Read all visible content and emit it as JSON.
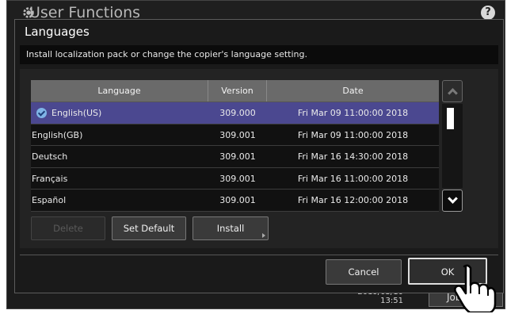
{
  "app": {
    "title": "User Functions",
    "help_label": "?",
    "time_line1": "2019/03/10",
    "time_line2": "13:51",
    "job_button": "Job S"
  },
  "dialog": {
    "title": "Languages",
    "description": "Install localization pack or change the copier's language setting.",
    "columns": [
      "Language",
      "Version",
      "Date"
    ],
    "rows": [
      {
        "language": "English(US)",
        "version": "309.000",
        "date": "Fri Mar 09 11:00:00 2018",
        "selected": true
      },
      {
        "language": "English(GB)",
        "version": "309.001",
        "date": "Fri Mar 09 11:00:00 2018",
        "selected": false
      },
      {
        "language": "Deutsch",
        "version": "309.001",
        "date": "Fri Mar 16 14:30:00 2018",
        "selected": false
      },
      {
        "language": "Français",
        "version": "309.001",
        "date": "Fri Mar 16 11:00:00 2018",
        "selected": false
      },
      {
        "language": "Español",
        "version": "309.001",
        "date": "Fri Mar 16 12:00:00 2018",
        "selected": false
      }
    ],
    "buttons": {
      "delete": "Delete",
      "set_default": "Set Default",
      "install": "Install",
      "cancel": "Cancel",
      "ok": "OK"
    }
  },
  "colors": {
    "selected_row": "#4b4890",
    "header": "#6a6a6a",
    "background": "#1a1a1a"
  },
  "icons": [
    "gear-icon",
    "help-icon",
    "check-icon",
    "chevron-up-icon",
    "chevron-down-icon",
    "pointing-hand-icon"
  ]
}
